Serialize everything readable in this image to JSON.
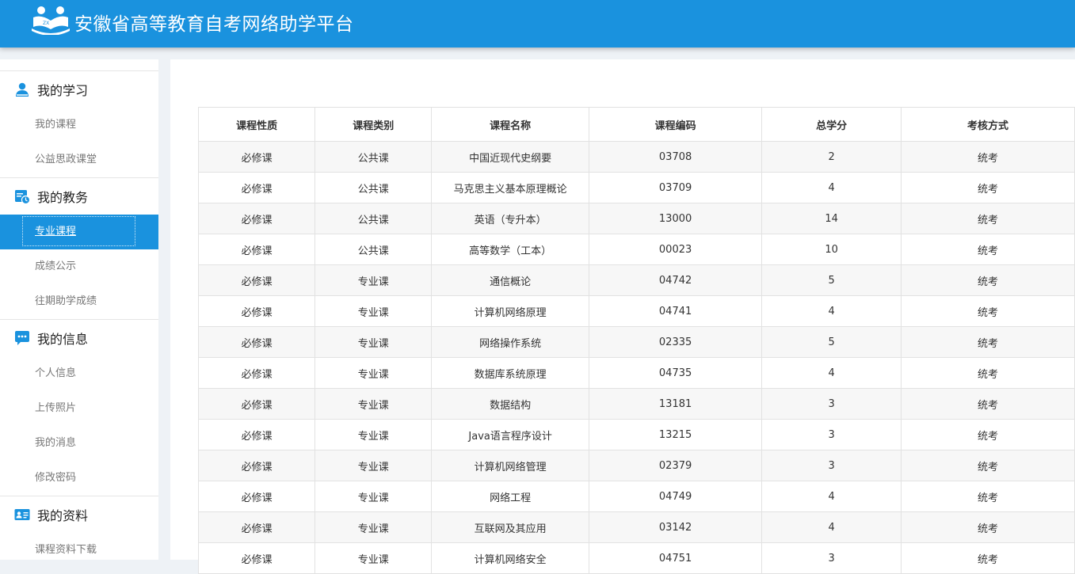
{
  "header": {
    "title": "安徽省高等教育自考网络助学平台",
    "logo_icon": "reading-people-logo-icon"
  },
  "colors": {
    "brand_blue": "#1a92de",
    "header_text": "#ffffff"
  },
  "sidebar": {
    "groups": [
      {
        "title": "我的学习",
        "icon": "user-icon",
        "items": [
          {
            "label": "我的课程"
          },
          {
            "label": "公益思政课堂"
          }
        ]
      },
      {
        "title": "我的教务",
        "icon": "calendar-clock-icon",
        "items": [
          {
            "label": "专业课程",
            "active": true
          },
          {
            "label": "成绩公示"
          },
          {
            "label": "往期助学成绩"
          }
        ]
      },
      {
        "title": "我的信息",
        "icon": "chat-bubble-icon",
        "items": [
          {
            "label": "个人信息"
          },
          {
            "label": "上传照片"
          },
          {
            "label": "我的消息"
          },
          {
            "label": "修改密码"
          }
        ]
      },
      {
        "title": "我的资料",
        "icon": "id-card-icon",
        "items": [
          {
            "label": "课程资料下载"
          }
        ]
      }
    ]
  },
  "table": {
    "headers": [
      "课程性质",
      "课程类别",
      "课程名称",
      "课程编码",
      "总学分",
      "考核方式"
    ],
    "rows": [
      [
        "必修课",
        "公共课",
        "中国近现代史纲要",
        "03708",
        "2",
        "统考"
      ],
      [
        "必修课",
        "公共课",
        "马克思主义基本原理概论",
        "03709",
        "4",
        "统考"
      ],
      [
        "必修课",
        "公共课",
        "英语（专升本）",
        "13000",
        "14",
        "统考"
      ],
      [
        "必修课",
        "公共课",
        "高等数学（工本）",
        "00023",
        "10",
        "统考"
      ],
      [
        "必修课",
        "专业课",
        "通信概论",
        "04742",
        "5",
        "统考"
      ],
      [
        "必修课",
        "专业课",
        "计算机网络原理",
        "04741",
        "4",
        "统考"
      ],
      [
        "必修课",
        "专业课",
        "网络操作系统",
        "02335",
        "5",
        "统考"
      ],
      [
        "必修课",
        "专业课",
        "数据库系统原理",
        "04735",
        "4",
        "统考"
      ],
      [
        "必修课",
        "专业课",
        "数据结构",
        "13181",
        "3",
        "统考"
      ],
      [
        "必修课",
        "专业课",
        "Java语言程序设计",
        "13215",
        "3",
        "统考"
      ],
      [
        "必修课",
        "专业课",
        "计算机网络管理",
        "02379",
        "3",
        "统考"
      ],
      [
        "必修课",
        "专业课",
        "网络工程",
        "04749",
        "4",
        "统考"
      ],
      [
        "必修课",
        "专业课",
        "互联网及其应用",
        "03142",
        "4",
        "统考"
      ],
      [
        "必修课",
        "专业课",
        "计算机网络安全",
        "04751",
        "3",
        "统考"
      ]
    ]
  }
}
